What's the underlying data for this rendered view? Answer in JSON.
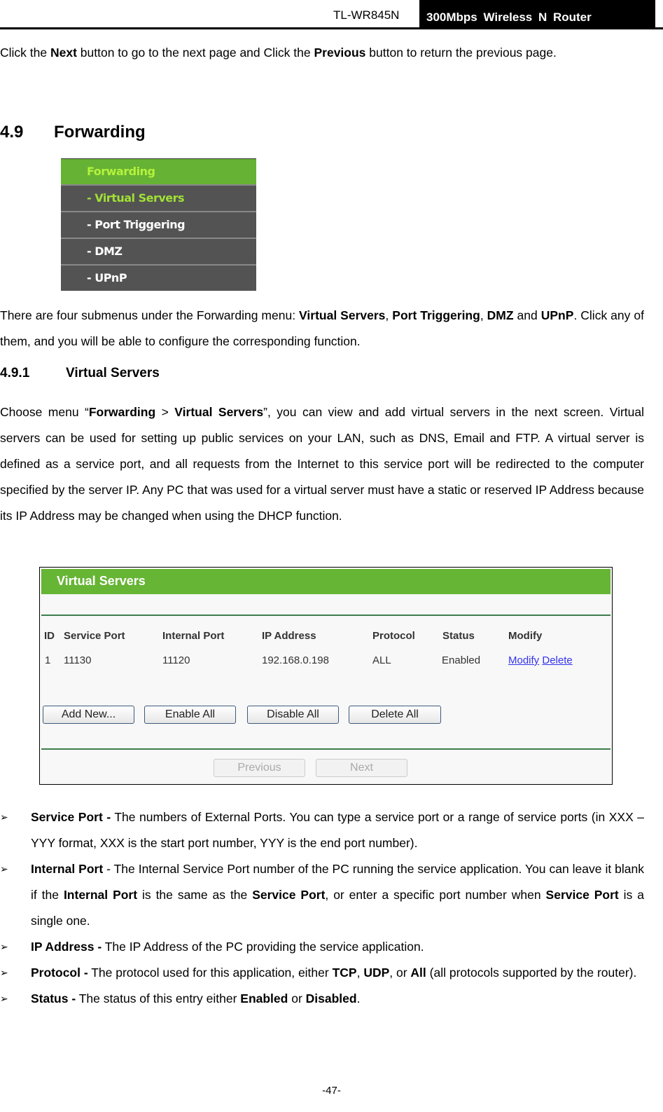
{
  "header": {
    "model": "TL-WR845N",
    "product": "300Mbps Wireless N Router"
  },
  "intro": {
    "p1": "Click the ",
    "p1_b1": "Next",
    "p1_2": " button to go to the next page and Click the ",
    "p1_b2": "Previous",
    "p1_3": " button to return the previous page."
  },
  "section": {
    "number": "4.9",
    "title": "Forwarding"
  },
  "menu": {
    "header": "Forwarding",
    "items": [
      {
        "label": "- Virtual Servers"
      },
      {
        "label": "- Port Triggering"
      },
      {
        "label": "- DMZ"
      },
      {
        "label": "- UPnP"
      }
    ]
  },
  "menu_desc": {
    "t1": "There are four submenus under the Forwarding menu: ",
    "b1": "Virtual Servers",
    "t2": ", ",
    "b2": "Port Triggering",
    "t3": ", ",
    "b3": "DMZ",
    "t4": " and ",
    "b4": "UPnP",
    "t5": ". Click any of them, and you will be able to configure the corresponding function."
  },
  "subsection": {
    "number": "4.9.1",
    "title": "Virtual Servers"
  },
  "vs_desc": {
    "t1": "Choose menu “",
    "b1": "Forwarding",
    "t2": " > ",
    "b2": "Virtual Servers",
    "t3": "”, you can view and add virtual servers in the next screen. Virtual servers can be used for setting up public services on your LAN, such as DNS, Email and FTP. A virtual server is defined as a service port, and all requests from the Internet to this service port will be redirected to the computer specified by the server IP. Any PC that was used for a virtual server must have a static or reserved IP Address because its IP Address may be changed when using the DHCP function."
  },
  "vs_panel": {
    "title": "Virtual Servers",
    "columns": [
      "ID",
      "Service Port",
      "Internal Port",
      "IP Address",
      "Protocol",
      "Status",
      "Modify"
    ],
    "rows": [
      {
        "id": "1",
        "service_port": "11130",
        "internal_port": "11120",
        "ip": "192.168.0.198",
        "protocol": "ALL",
        "status": "Enabled",
        "modify": "Modify",
        "delete": "Delete"
      }
    ],
    "buttons": {
      "add": "Add New...",
      "enable_all": "Enable All",
      "disable_all": "Disable All",
      "delete_all": "Delete All",
      "previous": "Previous",
      "next": "Next"
    }
  },
  "bullets": [
    {
      "b": "Service Port -",
      "t": " The numbers of External Ports. You can type a service port or a range of service ports (in XXX – YYY format, XXX is the start port number, YYY is the end port number)."
    },
    {
      "b": "Internal Port",
      "t": " - The Internal Service Port number of the PC running the service application. You can leave it blank if the ",
      "b2": "Internal Port",
      "t2": " is the same as the ",
      "b3": "Service Port",
      "t3": ", or enter a specific port number when ",
      "b4": "Service Port",
      "t4": " is a single one."
    },
    {
      "b": "IP Address -",
      "t": " The IP Address of the PC providing the service application."
    },
    {
      "b": "Protocol -",
      "t": " The protocol used for this application, either ",
      "b2": "TCP",
      "t2": ", ",
      "b3": "UDP",
      "t3": ", or ",
      "b4": "All",
      "t4": " (all protocols supported by the router)."
    },
    {
      "b": "Status -",
      "t": " The status of this entry either ",
      "b2": "Enabled",
      "t2": " or ",
      "b3": "Disabled",
      "t3": "."
    }
  ],
  "footer": {
    "page": "-47-"
  }
}
